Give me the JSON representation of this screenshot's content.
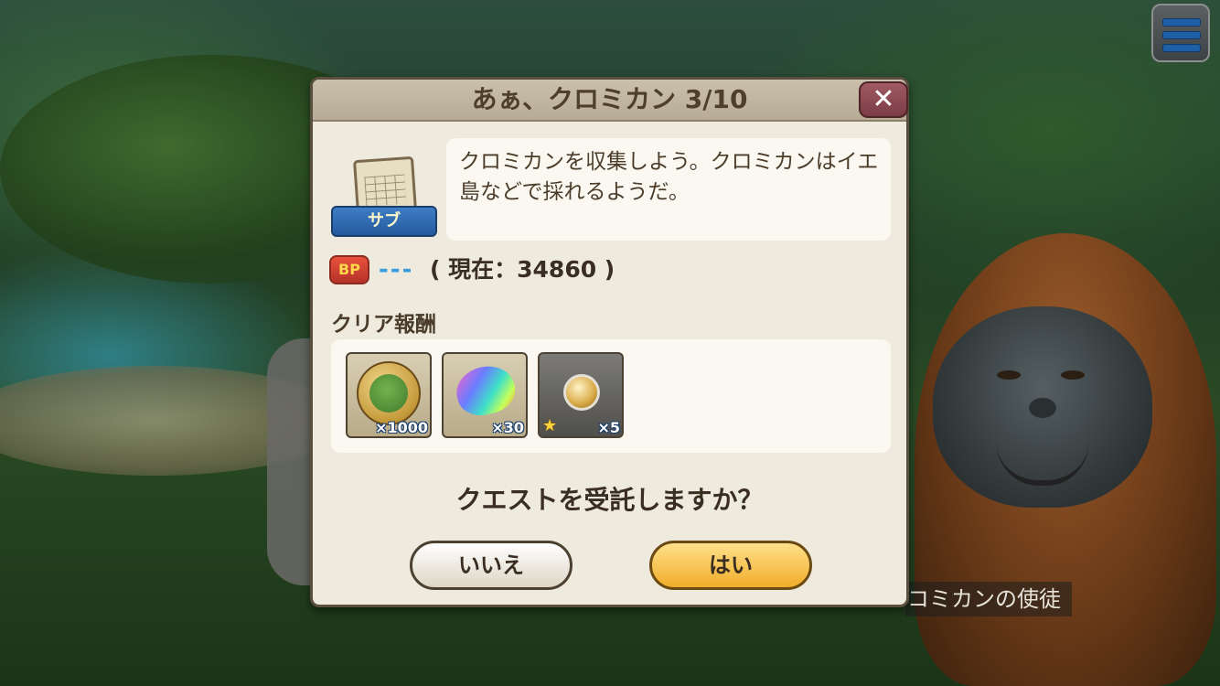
{
  "dialog": {
    "title": "あぁ、クロミカン 3/10",
    "close_label": "✕",
    "sub_icon_label": "サブ",
    "description": "クロミカンを収集しよう。クロミカンはイエ島などで採れるようだ。",
    "bp": {
      "badge": "BP",
      "value": "---",
      "current": "( 現在：34860 )"
    },
    "reward_label": "クリア報酬",
    "rewards": [
      {
        "icon": "medal-coin-icon",
        "qty": "×1000"
      },
      {
        "icon": "rainbow-gem-icon",
        "qty": "×30"
      },
      {
        "icon": "gold-orb-icon",
        "qty": "×5",
        "rarity": "★"
      }
    ],
    "question": "クエストを受託しますか？",
    "no_label": "いいえ",
    "yes_label": "はい"
  },
  "npc": {
    "name": "コミカンの使徒"
  },
  "hud": {
    "menu_icon": "hamburger-menu-icon"
  },
  "colors": {
    "accent_blue": "#3a9cdd",
    "yes_button": "#f0ad2a",
    "close_button": "#7a3c45",
    "dialog_bg": "#eeeadd"
  }
}
